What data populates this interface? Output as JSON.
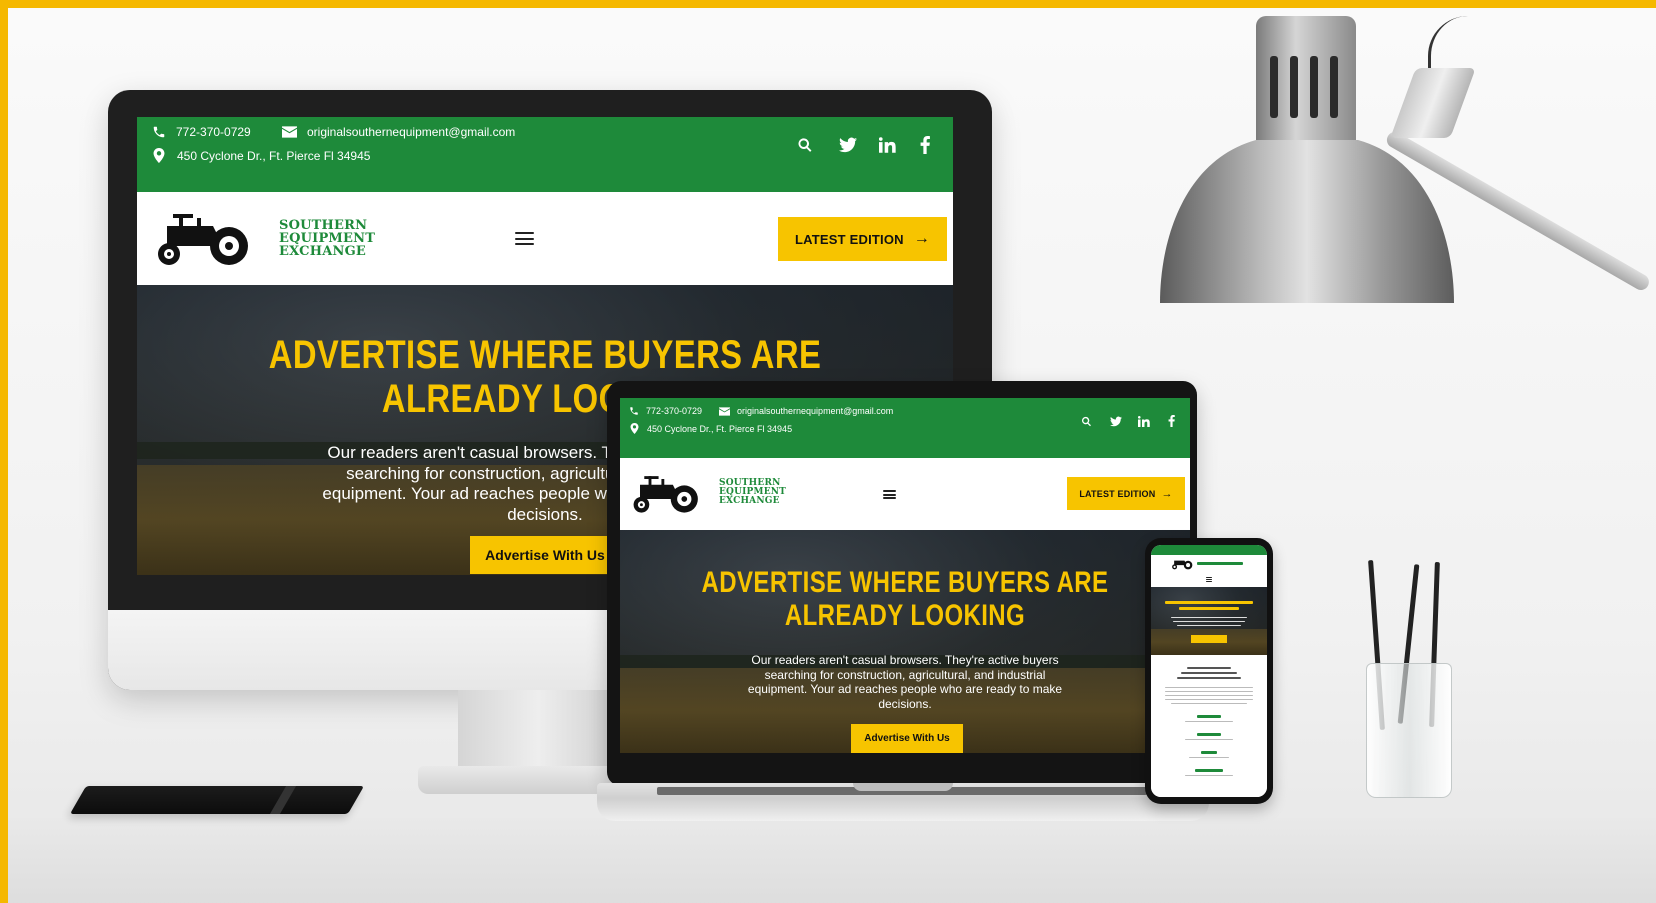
{
  "site": {
    "phone": "772-370-0729",
    "email": "originalsouthernequipment@gmail.com",
    "address": "450 Cyclone Dr., Ft. Pierce Fl 34945",
    "logo_lines": [
      "SOUTHERN",
      "EQUIPMENT",
      "EXCHANGE"
    ],
    "cta_label": "LATEST EDITION",
    "cta_arrow": "→",
    "hero": {
      "headline_1": "ADVERTISE WHERE BUYERS ARE",
      "headline_2": "ALREADY LOOKING",
      "body": "Our readers aren't casual browsers. They're active buyers searching for construction, agricultural, and industrial equipment. Your ad reaches people who are ready to make decisions.",
      "button": "Advertise With Us"
    }
  },
  "icons": [
    "phone-icon",
    "envelope-icon",
    "map-pin-icon",
    "search-icon",
    "twitter-icon",
    "linkedin-icon",
    "facebook-icon",
    "tractor-logo-icon",
    "hamburger-menu-icon"
  ],
  "colors": {
    "brand_green": "#1e8a3a",
    "accent_yellow": "#f7c400",
    "frame_border": "#f5b800"
  }
}
